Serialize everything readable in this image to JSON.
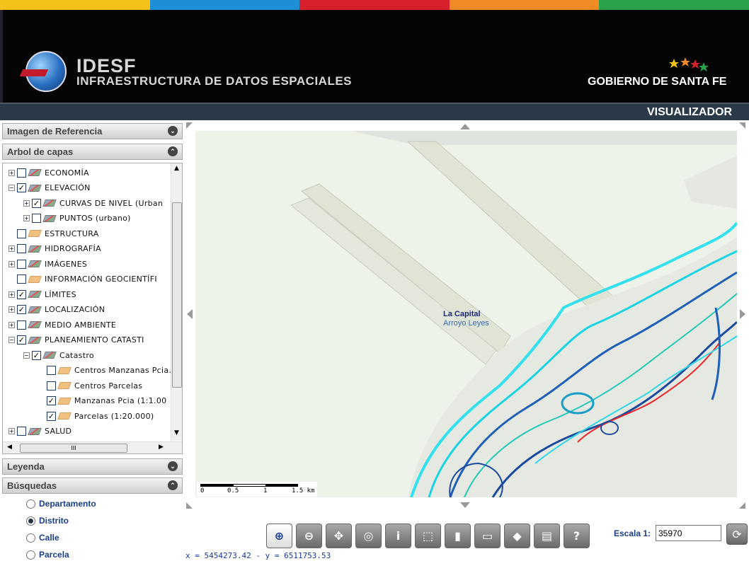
{
  "header": {
    "stripe_colors": [
      "#f5c21a",
      "#1e8fd6",
      "#d7202c",
      "#f08a24",
      "#2aa24a"
    ],
    "brand_title": "IDESF",
    "brand_subtitle": "INFRAESTRUCTURA DE DATOS ESPACIALES",
    "government": "GOBIERNO DE SANTA FE",
    "section": "VISUALIZADOR"
  },
  "panels": {
    "reference": "Imagen de Referencia",
    "layers": "Arbol de capas",
    "legend": "Leyenda",
    "search": "Búsquedas"
  },
  "layers": [
    {
      "label": "ECONOMÍA",
      "checked": false,
      "expander": "+",
      "indent": 0,
      "icon": "layer-icon"
    },
    {
      "label": "ELEVACIÓN",
      "checked": true,
      "expander": "−",
      "indent": 0,
      "icon": "layer-icon"
    },
    {
      "label": "CURVAS DE NIVEL (Urban",
      "checked": true,
      "expander": "+",
      "indent": 1,
      "icon": "layer-icon"
    },
    {
      "label": "PUNTOS (urbano)",
      "checked": false,
      "expander": "+",
      "indent": 1,
      "icon": "layer-icon"
    },
    {
      "label": "ESTRUCTURA",
      "checked": false,
      "expander": "",
      "indent": 0,
      "icon": "polygon-layer-icon"
    },
    {
      "label": "HIDROGRAFÍA",
      "checked": false,
      "expander": "+",
      "indent": 0,
      "icon": "layer-icon"
    },
    {
      "label": "IMÁGENES",
      "checked": false,
      "expander": "+",
      "indent": 0,
      "icon": "layer-icon"
    },
    {
      "label": "INFORMACIÓN GEOCIENTÍFI",
      "checked": false,
      "expander": "",
      "indent": 0,
      "icon": "polygon-layer-icon"
    },
    {
      "label": "LÍMITES",
      "checked": true,
      "expander": "+",
      "indent": 0,
      "icon": "layer-icon"
    },
    {
      "label": "LOCALIZACIÓN",
      "checked": true,
      "expander": "+",
      "indent": 0,
      "icon": "layer-icon"
    },
    {
      "label": "MEDIO AMBIENTE",
      "checked": false,
      "expander": "+",
      "indent": 0,
      "icon": "layer-icon"
    },
    {
      "label": "PLANEAMIENTO CATASTI",
      "checked": true,
      "expander": "−",
      "indent": 0,
      "icon": "layer-icon"
    },
    {
      "label": "Catastro",
      "checked": true,
      "expander": "−",
      "indent": 1,
      "icon": "layer-icon"
    },
    {
      "label": "Centros Manzanas Pcia.",
      "checked": false,
      "expander": "",
      "indent": 2,
      "icon": "polygon-layer-icon"
    },
    {
      "label": "Centros Parcelas",
      "checked": false,
      "expander": "",
      "indent": 2,
      "icon": "polygon-layer-icon"
    },
    {
      "label": "Manzanas Pcia (1:1.00",
      "checked": true,
      "expander": "",
      "indent": 2,
      "icon": "polygon-layer-icon"
    },
    {
      "label": "Parcelas (1:20.000)",
      "checked": true,
      "expander": "",
      "indent": 2,
      "icon": "polygon-layer-icon"
    },
    {
      "label": "SALUD",
      "checked": false,
      "expander": "+",
      "indent": 0,
      "icon": "layer-icon"
    }
  ],
  "search_options": [
    {
      "label": "Departamento",
      "selected": false
    },
    {
      "label": "Distrito",
      "selected": true
    },
    {
      "label": "Calle",
      "selected": false
    },
    {
      "label": "Parcela",
      "selected": false
    }
  ],
  "map": {
    "label_1": "La Capital",
    "label_2": "Arroyo Leyes",
    "scale_ticks": [
      "0",
      "0.5",
      "1",
      "1.5 km"
    ]
  },
  "toolbar": [
    {
      "name": "zoom-in-tool",
      "icon": "zoom-in-icon",
      "glyph": "⊕",
      "active": true
    },
    {
      "name": "zoom-out-tool",
      "icon": "zoom-out-icon",
      "glyph": "⊖",
      "active": false
    },
    {
      "name": "pan-tool",
      "icon": "pan-icon",
      "glyph": "✥",
      "active": false
    },
    {
      "name": "full-extent-tool",
      "icon": "globe-icon",
      "glyph": "◎",
      "active": false
    },
    {
      "name": "identify-tool",
      "icon": "identify-icon",
      "glyph": "i",
      "active": false
    },
    {
      "name": "select-info-tool",
      "icon": "select-info-icon",
      "glyph": "⬚",
      "active": false
    },
    {
      "name": "measure-tool",
      "icon": "ruler-icon",
      "glyph": "▮",
      "active": false
    },
    {
      "name": "scale-tool",
      "icon": "scale-icon",
      "glyph": "▭",
      "active": false
    },
    {
      "name": "area-tool",
      "icon": "area-icon",
      "glyph": "◆",
      "active": false
    },
    {
      "name": "print-tool",
      "icon": "print-icon",
      "glyph": "▤",
      "active": false
    },
    {
      "name": "help-tool",
      "icon": "help-icon",
      "glyph": "?",
      "active": false
    }
  ],
  "scale": {
    "label": "Escala 1:",
    "value": "35970"
  },
  "coordinates": "x = 5454273.42 - y = 6511753.53"
}
